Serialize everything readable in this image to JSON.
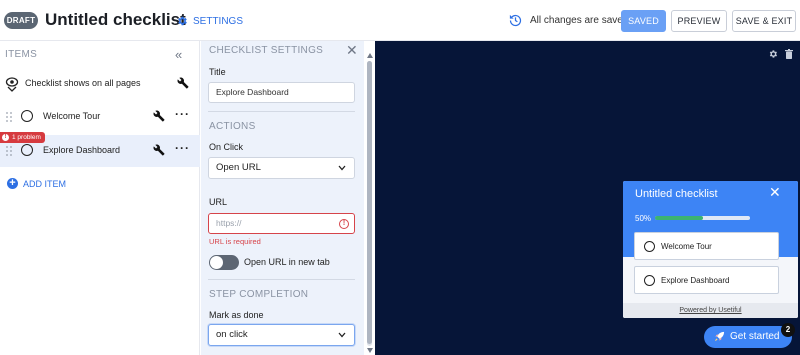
{
  "header": {
    "draft_badge": "DRAFT",
    "title": "Untitled checklist",
    "settings_label": "SETTINGS",
    "save_status": "All changes are saved",
    "saved_button": "SAVED",
    "preview_button": "PREVIEW",
    "save_exit_button": "SAVE & EXIT"
  },
  "items_panel": {
    "header": "ITEMS",
    "global_row": "Checklist shows on all pages",
    "items": [
      {
        "label": "Welcome Tour"
      },
      {
        "label": "Explore Dashboard",
        "problem": "1 problem"
      }
    ],
    "add_item": "ADD ITEM"
  },
  "settings_panel": {
    "header": "CHECKLIST SETTINGS",
    "title_label": "Title",
    "title_value": "Explore Dashboard",
    "actions_section": "ACTIONS",
    "on_click_label": "On Click",
    "on_click_value": "Open URL",
    "url_label": "URL",
    "url_placeholder": "https://",
    "url_error": "URL is required",
    "new_tab_label": "Open URL in new tab",
    "new_tab_enabled": false,
    "step_completion_section": "STEP COMPLETION",
    "mark_done_label": "Mark as done",
    "mark_done_value": "on click"
  },
  "preview": {
    "widget_title": "Untitled checklist",
    "progress_text": "50%",
    "progress": 0.5,
    "items": [
      "Welcome Tour",
      "Explore Dashboard"
    ],
    "powered_by": "Powered by Usetiful",
    "launcher_label": "Get started",
    "launcher_count": "2"
  },
  "colors": {
    "accent": "#2d6fe3",
    "canvas_bg": "#061538",
    "widget_blue": "#3d84f5",
    "error": "#d6444a",
    "progress_green": "#3cb371"
  }
}
